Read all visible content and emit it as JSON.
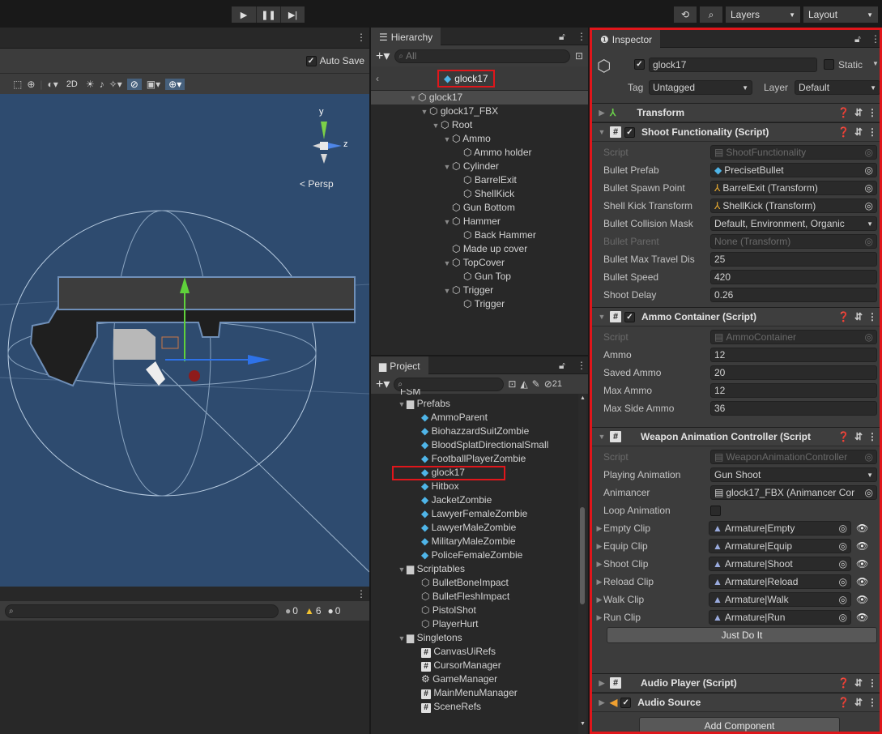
{
  "toolbar": {
    "layers_label": "Layers",
    "layout_label": "Layout"
  },
  "scene": {
    "auto_save_label": "Auto Save",
    "mode_2d": "2D",
    "persp_label": "< Persp",
    "axis_y": "y",
    "axis_z": "z"
  },
  "console": {
    "info_count": "0",
    "warn_count": "6",
    "error_count": "0"
  },
  "hierarchy": {
    "tab_label": "Hierarchy",
    "search_placeholder": "All",
    "breadcrumb": "glock17",
    "items": [
      {
        "label": "glock17",
        "indent": 0,
        "arrow": true
      },
      {
        "label": "glock17_FBX",
        "indent": 1,
        "arrow": true
      },
      {
        "label": "Root",
        "indent": 2,
        "arrow": true
      },
      {
        "label": "Ammo",
        "indent": 3,
        "arrow": true
      },
      {
        "label": "Ammo holder",
        "indent": 4,
        "arrow": false
      },
      {
        "label": "Cylinder",
        "indent": 3,
        "arrow": true
      },
      {
        "label": "BarrelExit",
        "indent": 4,
        "arrow": false
      },
      {
        "label": "ShellKick",
        "indent": 4,
        "arrow": false
      },
      {
        "label": "Gun Bottom",
        "indent": 3,
        "arrow": false
      },
      {
        "label": "Hammer",
        "indent": 3,
        "arrow": true
      },
      {
        "label": "Back Hammer",
        "indent": 4,
        "arrow": false
      },
      {
        "label": "Made up cover",
        "indent": 3,
        "arrow": false
      },
      {
        "label": "TopCover",
        "indent": 3,
        "arrow": true
      },
      {
        "label": "Gun Top",
        "indent": 4,
        "arrow": false
      },
      {
        "label": "Trigger",
        "indent": 3,
        "arrow": true
      },
      {
        "label": "Trigger",
        "indent": 4,
        "arrow": false
      }
    ]
  },
  "project": {
    "tab_label": "Project",
    "hidden_count": "21",
    "partial_item": "FSM",
    "items": [
      {
        "label": "Prefabs",
        "type": "folder",
        "indent": 0
      },
      {
        "label": "AmmoParent",
        "type": "prefab",
        "indent": 1
      },
      {
        "label": "BiohazzardSuitZombie",
        "type": "prefab",
        "indent": 1
      },
      {
        "label": "BloodSplatDirectionalSmall",
        "type": "prefab",
        "indent": 1
      },
      {
        "label": "FootballPlayerZombie",
        "type": "prefab",
        "indent": 1
      },
      {
        "label": "glock17",
        "type": "prefab",
        "indent": 1
      },
      {
        "label": "Hitbox",
        "type": "prefab",
        "indent": 1
      },
      {
        "label": "JacketZombie",
        "type": "prefab",
        "indent": 1
      },
      {
        "label": "LawyerFemaleZombie",
        "type": "prefab",
        "indent": 1
      },
      {
        "label": "LawyerMaleZombie",
        "type": "prefab",
        "indent": 1
      },
      {
        "label": "MilitaryMaleZombie",
        "type": "prefab",
        "indent": 1
      },
      {
        "label": "PoliceFemaleZombie",
        "type": "prefab",
        "indent": 1
      },
      {
        "label": "Scriptables",
        "type": "folder",
        "indent": 0
      },
      {
        "label": "BulletBoneImpact",
        "type": "so",
        "indent": 1
      },
      {
        "label": "BulletFleshImpact",
        "type": "so",
        "indent": 1
      },
      {
        "label": "PistolShot",
        "type": "so",
        "indent": 1
      },
      {
        "label": "PlayerHurt",
        "type": "so",
        "indent": 1
      },
      {
        "label": "Singletons",
        "type": "folder",
        "indent": 0
      },
      {
        "label": "CanvasUiRefs",
        "type": "script",
        "indent": 1
      },
      {
        "label": "CursorManager",
        "type": "script",
        "indent": 1
      },
      {
        "label": "GameManager",
        "type": "gear",
        "indent": 1
      },
      {
        "label": "MainMenuManager",
        "type": "script",
        "indent": 1
      },
      {
        "label": "SceneRefs",
        "type": "script",
        "indent": 1
      }
    ]
  },
  "inspector": {
    "tab_label": "Inspector",
    "object_name": "glock17",
    "static_label": "Static",
    "tag_label": "Tag",
    "tag_value": "Untagged",
    "layer_label": "Layer",
    "layer_value": "Default",
    "transform_label": "Transform",
    "shoot": {
      "title": "Shoot Functionality (Script)",
      "rows": [
        {
          "label": "Script",
          "value": "ShootFunctionality",
          "dim": true,
          "icon": "doc"
        },
        {
          "label": "Bullet Prefab",
          "value": "PrecisetBullet",
          "icon": "cube"
        },
        {
          "label": "Bullet Spawn Point",
          "value": "BarrelExit (Transform)",
          "icon": "transform"
        },
        {
          "label": "Shell Kick Transform",
          "value": "ShellKick (Transform)",
          "icon": "transform"
        },
        {
          "label": "Bullet Collision Mask",
          "value": "Default, Environment, Organic",
          "icon": "dropdown"
        },
        {
          "label": "Bullet Parent",
          "value": "None (Transform)",
          "dim": true,
          "icon": "none"
        },
        {
          "label": "Bullet Max Travel Dis",
          "value": "25",
          "icon": "text"
        },
        {
          "label": "Bullet Speed",
          "value": "420",
          "icon": "text"
        },
        {
          "label": "Shoot Delay",
          "value": "0.26",
          "icon": "text"
        }
      ]
    },
    "ammo": {
      "title": "Ammo Container (Script)",
      "rows": [
        {
          "label": "Script",
          "value": "AmmoContainer",
          "dim": true,
          "icon": "doc"
        },
        {
          "label": "Ammo",
          "value": "12",
          "icon": "text"
        },
        {
          "label": "Saved Ammo",
          "value": "20",
          "icon": "text"
        },
        {
          "label": "Max Ammo",
          "value": "12",
          "icon": "text"
        },
        {
          "label": "Max Side Ammo",
          "value": "36",
          "icon": "text"
        }
      ]
    },
    "weapon": {
      "title": "Weapon Animation Controller (Script",
      "script_label": "Script",
      "script_value": "WeaponAnimationController",
      "playing_label": "Playing Animation",
      "playing_value": "Gun Shoot",
      "animancer_label": "Animancer",
      "animancer_value": "glock17_FBX (Animancer Cor",
      "loop_label": "Loop Animation",
      "clips": [
        {
          "label": "Empty Clip",
          "value": "Armature|Empty"
        },
        {
          "label": "Equip Clip",
          "value": "Armature|Equip"
        },
        {
          "label": "Shoot Clip",
          "value": "Armature|Shoot"
        },
        {
          "label": "Reload Clip",
          "value": "Armature|Reload"
        },
        {
          "label": "Walk Clip",
          "value": "Armature|Walk"
        },
        {
          "label": "Run Clip",
          "value": "Armature|Run"
        }
      ],
      "button_label": "Just Do It"
    },
    "audio_player_title": "Audio Player (Script)",
    "audio_source_title": "Audio Source",
    "add_component_label": "Add Component"
  },
  "colors": {
    "highlight_red": "#e0161b",
    "selection": "#2c5d87",
    "scene_bg": "#2d4c70",
    "prefab_blue": "#4fb5e8"
  }
}
